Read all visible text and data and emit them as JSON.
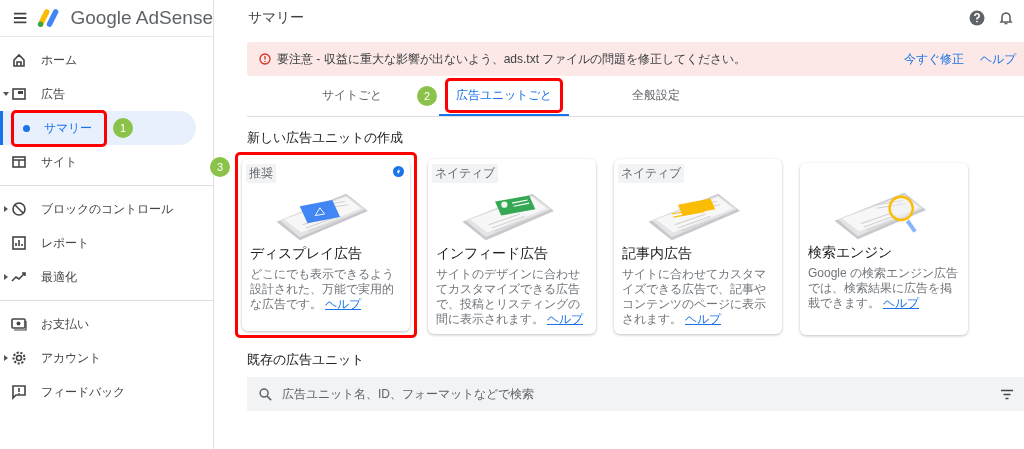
{
  "app": {
    "logo_text": "Google AdSense",
    "page_title": "サマリー"
  },
  "sidebar": {
    "sections": [
      [
        {
          "label": "ホーム",
          "kind": "link",
          "selected": false
        },
        {
          "label": "広告",
          "kind": "group",
          "expanded": true,
          "selected": false,
          "children": [
            {
              "label": "サマリー",
              "kind": "sub",
              "selected": true,
              "callout": "1"
            },
            {
              "label": "サイト",
              "kind": "link",
              "selected": false
            }
          ]
        }
      ],
      [
        {
          "label": "ブロックのコントロール",
          "kind": "group",
          "expanded": false,
          "selected": false
        },
        {
          "label": "レポート",
          "kind": "link",
          "selected": false
        },
        {
          "label": "最適化",
          "kind": "group",
          "expanded": false,
          "selected": false
        }
      ],
      [
        {
          "label": "お支払い",
          "kind": "link",
          "selected": false
        },
        {
          "label": "アカウント",
          "kind": "group",
          "expanded": false,
          "selected": false
        },
        {
          "label": "フィードバック",
          "kind": "link",
          "selected": false
        }
      ]
    ]
  },
  "alert": {
    "message": "要注意 - 収益に重大な影響が出ないよう、ads.txt ファイルの問題を修正してください。",
    "actions": [
      "今すぐ修正",
      "ヘルプ"
    ]
  },
  "tabs": [
    {
      "label": "サイトごと",
      "selected": false
    },
    {
      "label": "広告ユニットごと",
      "selected": true,
      "callout": "2"
    },
    {
      "label": "全般設定",
      "selected": false
    }
  ],
  "new_section": {
    "title": "新しい広告ユニットの作成"
  },
  "cards": [
    {
      "kind": "display",
      "badge": "推奨",
      "boosted": true,
      "title": "ディスプレイ広告",
      "description": "どこにでも表示できるよう設計された、万能で実用的な広告です。",
      "link": "ヘルプ",
      "callout": "3"
    },
    {
      "kind": "infeed",
      "badge": "ネイティブ",
      "boosted": false,
      "title": "インフィード広告",
      "description": "サイトのデザインに合わせてカスタマイズできる広告で、投稿とリスティングの間に表示されます。",
      "link": "ヘルプ"
    },
    {
      "kind": "inarticle",
      "badge": "ネイティブ",
      "boosted": false,
      "title": "記事内広告",
      "description": "サイトに合わせてカスタマイズできる広告で、記事やコンテンツのページに表示されます。",
      "link": "ヘルプ"
    },
    {
      "kind": "search",
      "boosted": false,
      "title": "検索エンジン",
      "description": "Google の検索エンジン広告では、検索結果に広告を掲載できます。",
      "link": "ヘルプ"
    }
  ],
  "existing_section": {
    "title": "既存の広告ユニット"
  },
  "search": {
    "placeholder": "広告ユニット名、ID、フォーマットなどで検索"
  }
}
